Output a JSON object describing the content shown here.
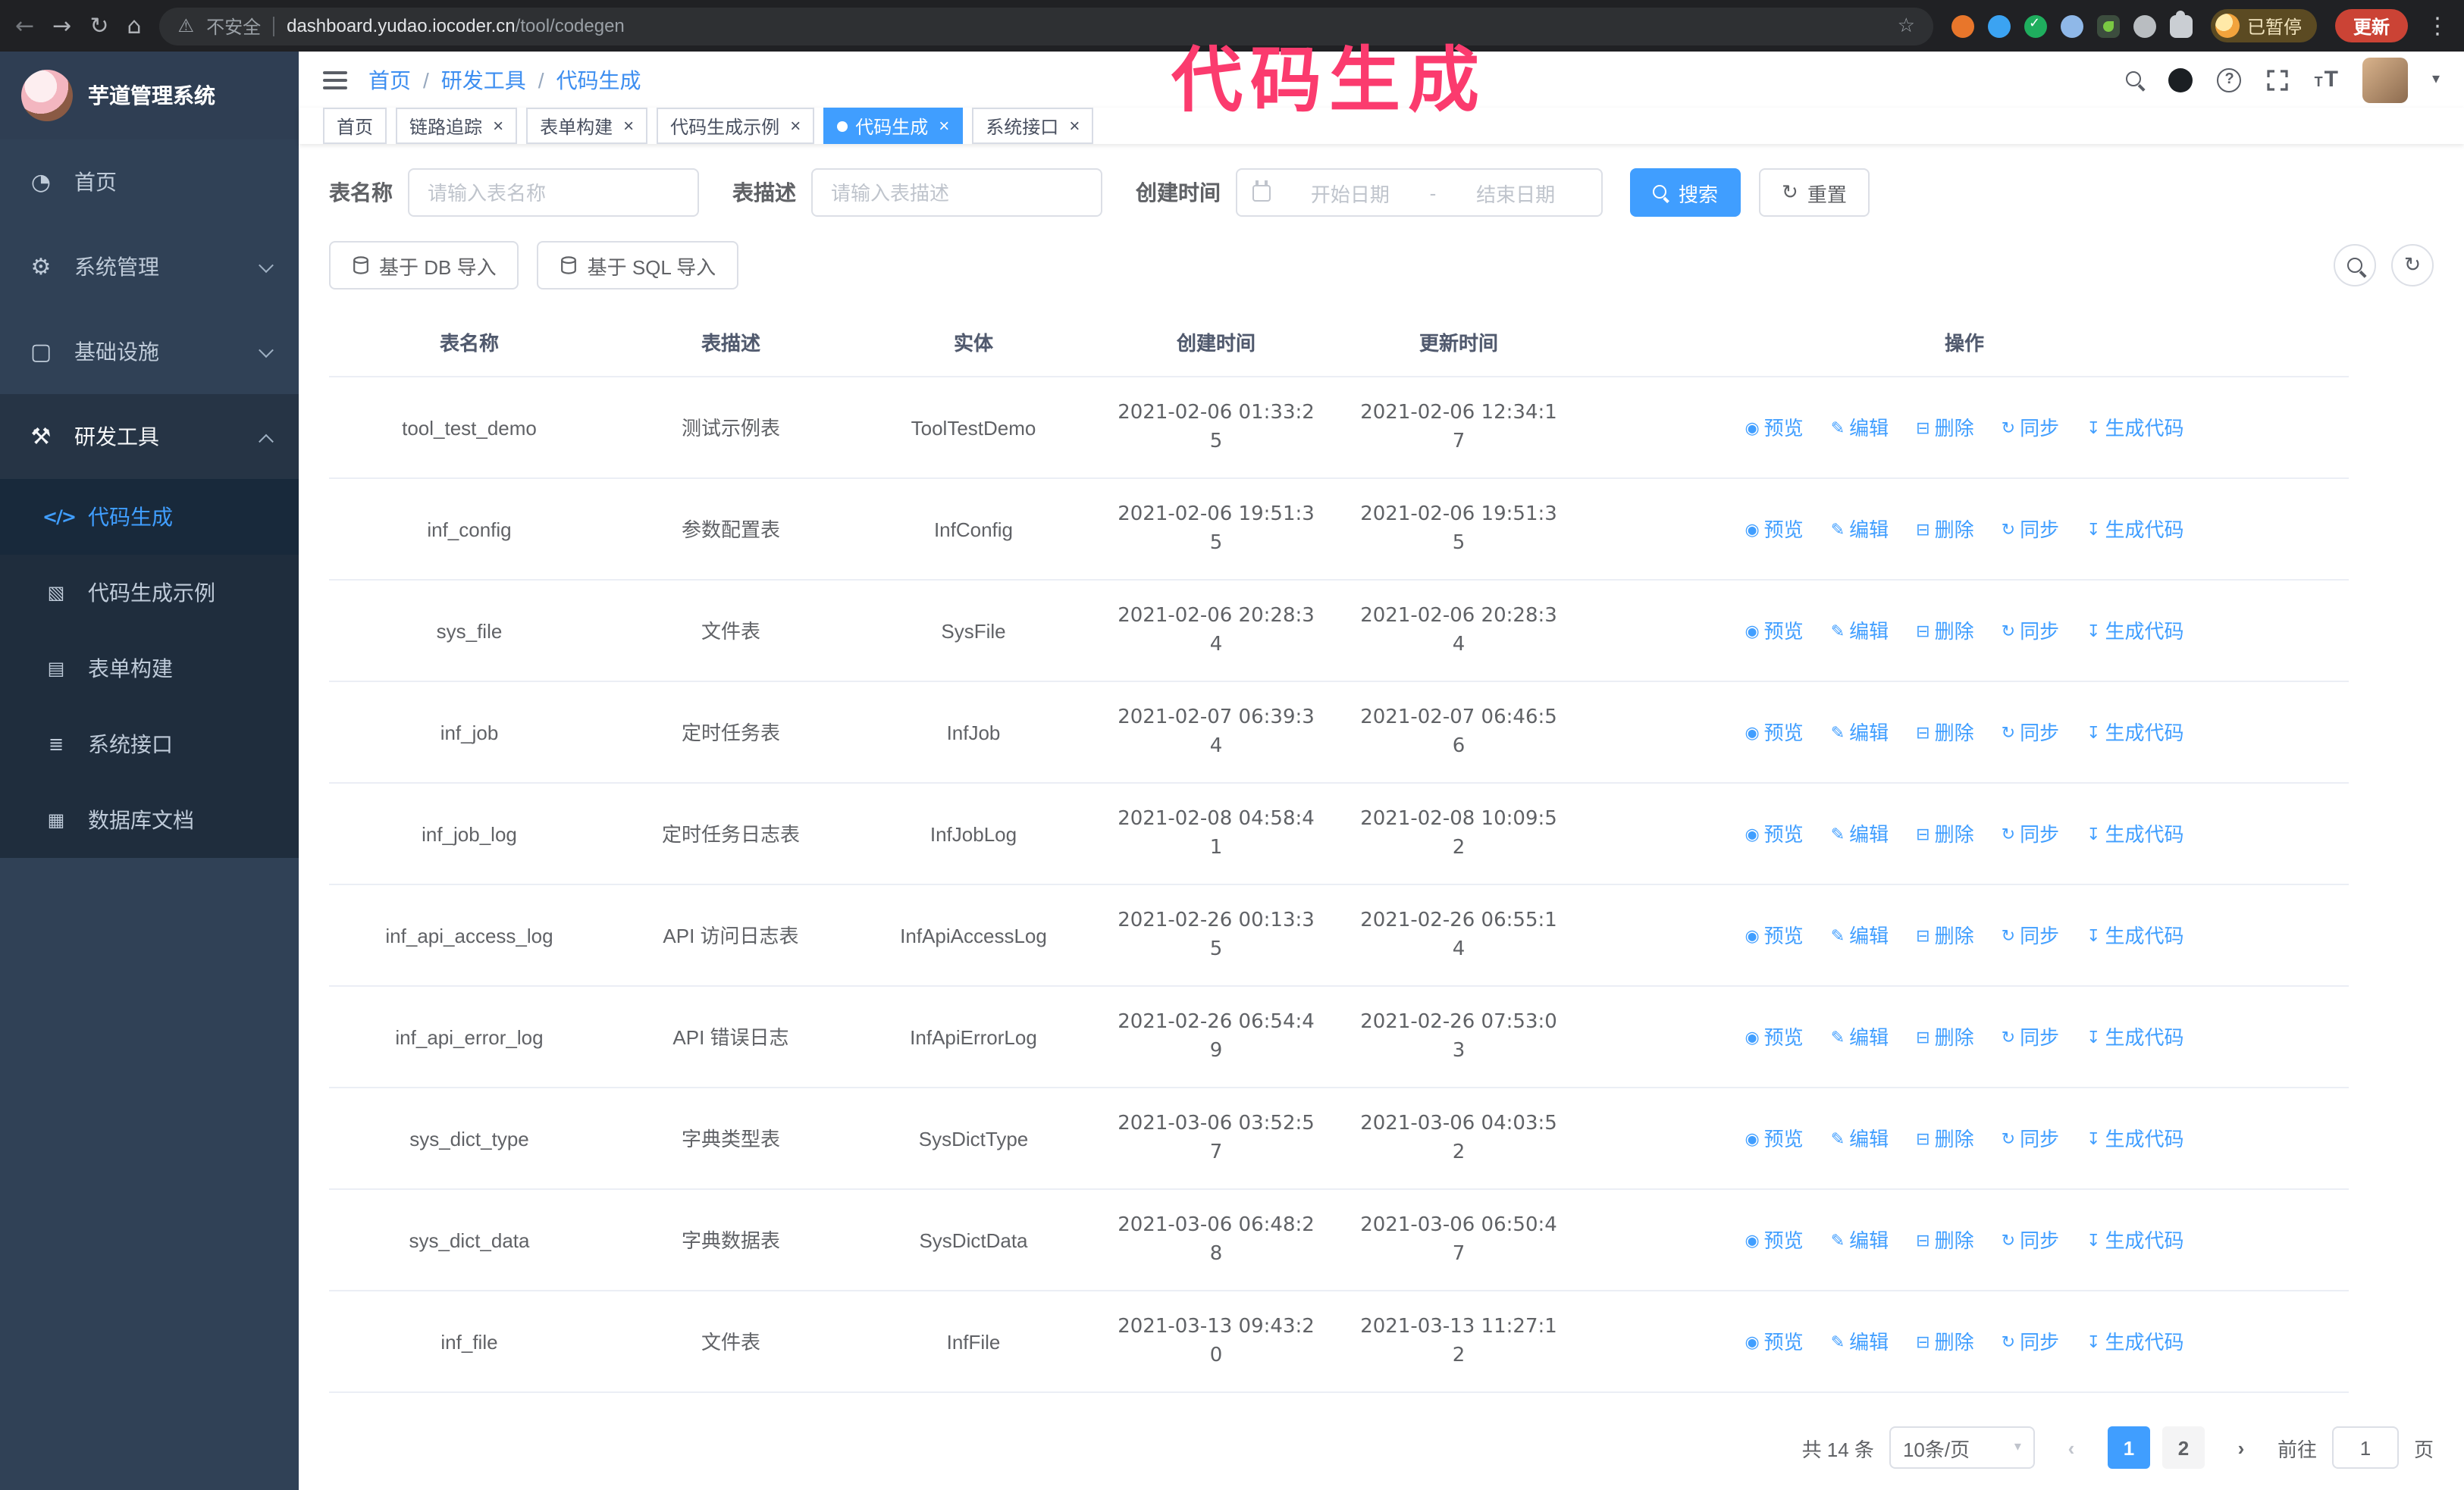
{
  "annotation": {
    "text": "代码生成"
  },
  "browser": {
    "insecure_label": "不安全",
    "url_host": "dashboard.yudao.iocoder.cn",
    "url_path": "/tool/codegen",
    "paused_badge": "已暂停",
    "update_button": "更新"
  },
  "sidebar": {
    "app_title": "芋道管理系统",
    "items": [
      {
        "key": "home",
        "label": "首页",
        "icon": "dashboard-icon"
      },
      {
        "key": "system",
        "label": "系统管理",
        "icon": "gear-icon",
        "chevron": "down"
      },
      {
        "key": "infra",
        "label": "基础设施",
        "icon": "infra-icon",
        "chevron": "down"
      },
      {
        "key": "devtools",
        "label": "研发工具",
        "icon": "tools-icon",
        "chevron": "up",
        "expanded": true
      }
    ],
    "submenu": [
      {
        "key": "codegen",
        "label": "代码生成",
        "icon": "code-icon",
        "active": true
      },
      {
        "key": "codegen-example",
        "label": "代码生成示例",
        "icon": "example-icon"
      },
      {
        "key": "form-builder",
        "label": "表单构建",
        "icon": "form-icon"
      },
      {
        "key": "system-api",
        "label": "系统接口",
        "icon": "api-icon"
      },
      {
        "key": "db-doc",
        "label": "数据库文档",
        "icon": "db-doc-icon"
      }
    ]
  },
  "header": {
    "breadcrumb": [
      "首页",
      "研发工具",
      "代码生成"
    ]
  },
  "tabs": [
    {
      "label": "首页",
      "closable": false,
      "active": false
    },
    {
      "label": "链路追踪",
      "closable": true,
      "active": false
    },
    {
      "label": "表单构建",
      "closable": true,
      "active": false
    },
    {
      "label": "代码生成示例",
      "closable": true,
      "active": false
    },
    {
      "label": "代码生成",
      "closable": true,
      "active": true
    },
    {
      "label": "系统接口",
      "closable": true,
      "active": false
    }
  ],
  "filters": {
    "table_name_label": "表名称",
    "table_name_placeholder": "请输入表名称",
    "table_desc_label": "表描述",
    "table_desc_placeholder": "请输入表描述",
    "create_time_label": "创建时间",
    "date_start_placeholder": "开始日期",
    "date_separator": "-",
    "date_end_placeholder": "结束日期",
    "search_button": "搜索",
    "reset_button": "重置"
  },
  "toolbar": {
    "import_db": "基于 DB 导入",
    "import_sql": "基于 SQL 导入"
  },
  "table": {
    "columns": [
      "表名称",
      "表描述",
      "实体",
      "创建时间",
      "更新时间",
      "操作"
    ],
    "ops": [
      {
        "key": "preview",
        "label": "预览",
        "icon": "eye-icon"
      },
      {
        "key": "edit",
        "label": "编辑",
        "icon": "edit-icon"
      },
      {
        "key": "delete",
        "label": "删除",
        "icon": "delete-icon"
      },
      {
        "key": "sync",
        "label": "同步",
        "icon": "sync-icon"
      },
      {
        "key": "generate",
        "label": "生成代码",
        "icon": "generate-icon"
      }
    ],
    "rows": [
      {
        "name": "tool_test_demo",
        "desc": "测试示例表",
        "entity": "ToolTestDemo",
        "created": "2021-02-06 01:33:25",
        "updated": "2021-02-06 12:34:17"
      },
      {
        "name": "inf_config",
        "desc": "参数配置表",
        "entity": "InfConfig",
        "created": "2021-02-06 19:51:35",
        "updated": "2021-02-06 19:51:35"
      },
      {
        "name": "sys_file",
        "desc": "文件表",
        "entity": "SysFile",
        "created": "2021-02-06 20:28:34",
        "updated": "2021-02-06 20:28:34"
      },
      {
        "name": "inf_job",
        "desc": "定时任务表",
        "entity": "InfJob",
        "created": "2021-02-07 06:39:34",
        "updated": "2021-02-07 06:46:56"
      },
      {
        "name": "inf_job_log",
        "desc": "定时任务日志表",
        "entity": "InfJobLog",
        "created": "2021-02-08 04:58:41",
        "updated": "2021-02-08 10:09:52"
      },
      {
        "name": "inf_api_access_log",
        "desc": "API 访问日志表",
        "entity": "InfApiAccessLog",
        "created": "2021-02-26 00:13:35",
        "updated": "2021-02-26 06:55:14"
      },
      {
        "name": "inf_api_error_log",
        "desc": "API 错误日志",
        "entity": "InfApiErrorLog",
        "created": "2021-02-26 06:54:49",
        "updated": "2021-02-26 07:53:03"
      },
      {
        "name": "sys_dict_type",
        "desc": "字典类型表",
        "entity": "SysDictType",
        "created": "2021-03-06 03:52:57",
        "updated": "2021-03-06 04:03:52"
      },
      {
        "name": "sys_dict_data",
        "desc": "字典数据表",
        "entity": "SysDictData",
        "created": "2021-03-06 06:48:28",
        "updated": "2021-03-06 06:50:47"
      },
      {
        "name": "inf_file",
        "desc": "文件表",
        "entity": "InfFile",
        "created": "2021-03-13 09:43:20",
        "updated": "2021-03-13 11:27:12"
      }
    ]
  },
  "pagination": {
    "total": "共 14 条",
    "page_size": "10条/页",
    "pages": [
      "1",
      "2"
    ],
    "active_page": "1",
    "goto_label": "前往",
    "goto_value": "1",
    "page_suffix": "页"
  }
}
